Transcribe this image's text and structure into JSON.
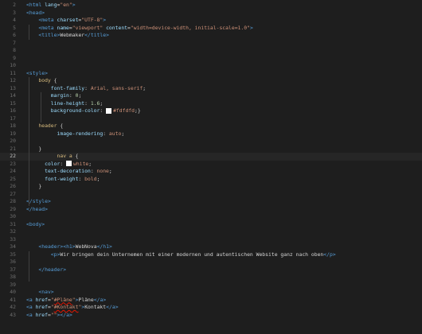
{
  "colors": {
    "background": "#1e1e1e",
    "tag": "#569cd6",
    "attr": "#9cdcfe",
    "string": "#ce9178",
    "selector": "#d7ba7d",
    "number": "#b5cea8",
    "text": "#d4d4d4",
    "brace": "#ffd700"
  },
  "editor": {
    "current_line": 22,
    "lines": [
      {
        "n": "2",
        "indent": 0,
        "t": [
          [
            "<",
            "tag"
          ],
          [
            "html",
            "tag"
          ],
          [
            " lang",
            "attr"
          ],
          [
            "=",
            "punc"
          ],
          [
            "\"en\"",
            "str"
          ],
          [
            ">",
            "tag"
          ]
        ]
      },
      {
        "n": "3",
        "indent": 0,
        "t": [
          [
            "<",
            "tag"
          ],
          [
            "head",
            "tag"
          ],
          [
            ">",
            "tag"
          ]
        ]
      },
      {
        "n": "4",
        "indent": 4,
        "t": [
          [
            "<",
            "tag"
          ],
          [
            "meta",
            "tag"
          ],
          [
            " charset",
            "attr"
          ],
          [
            "=",
            "punc"
          ],
          [
            "\"UTF-8\"",
            "str"
          ],
          [
            ">",
            "tag"
          ]
        ]
      },
      {
        "n": "5",
        "indent": 4,
        "t": [
          [
            "<",
            "tag"
          ],
          [
            "meta",
            "tag"
          ],
          [
            " name",
            "attr"
          ],
          [
            "=",
            "punc"
          ],
          [
            "\"viewport\"",
            "str"
          ],
          [
            " content",
            "attr"
          ],
          [
            "=",
            "punc"
          ],
          [
            "\"width=device-width, initial-scale=1.0\"",
            "str"
          ],
          [
            ">",
            "tag"
          ]
        ]
      },
      {
        "n": "6",
        "indent": 4,
        "t": [
          [
            "<",
            "tag"
          ],
          [
            "title",
            "tag"
          ],
          [
            ">",
            "tag"
          ],
          [
            "Webmaker",
            "text"
          ],
          [
            "</",
            "tag"
          ],
          [
            "title",
            "tag"
          ],
          [
            ">",
            "tag"
          ]
        ]
      },
      {
        "n": "7",
        "indent": 0,
        "t": []
      },
      {
        "n": "8",
        "indent": 0,
        "t": []
      },
      {
        "n": "9",
        "indent": 0,
        "t": []
      },
      {
        "n": "10",
        "indent": 0,
        "t": []
      },
      {
        "n": "11",
        "indent": 0,
        "t": [
          [
            "<",
            "tag"
          ],
          [
            "style",
            "tag"
          ],
          [
            ">",
            "tag"
          ]
        ]
      },
      {
        "n": "12",
        "indent": 4,
        "t": [
          [
            "body",
            "sel"
          ],
          [
            " {",
            "punc"
          ]
        ]
      },
      {
        "n": "13",
        "indent": 8,
        "t": [
          [
            "font-family",
            "prop"
          ],
          [
            ": ",
            "punc"
          ],
          [
            "Arial, sans-serif",
            "val"
          ],
          [
            ";",
            "punc"
          ]
        ]
      },
      {
        "n": "14",
        "indent": 8,
        "t": [
          [
            "margin",
            "prop"
          ],
          [
            ": ",
            "punc"
          ],
          [
            "0",
            "num"
          ],
          [
            ";",
            "punc"
          ]
        ]
      },
      {
        "n": "15",
        "indent": 8,
        "t": [
          [
            "line-height",
            "prop"
          ],
          [
            ": ",
            "punc"
          ],
          [
            "1.6",
            "num"
          ],
          [
            ";",
            "punc"
          ]
        ]
      },
      {
        "n": "16",
        "indent": 8,
        "t": [
          [
            "background-color",
            "prop"
          ],
          [
            ": ",
            "punc"
          ],
          [
            "swatch:#fdfdfd",
            "swatch"
          ],
          [
            "#fdfdfd",
            "val"
          ],
          [
            ";}",
            "punc"
          ]
        ]
      },
      {
        "n": "17",
        "indent": 0,
        "t": []
      },
      {
        "n": "18",
        "indent": 4,
        "t": [
          [
            "header",
            "sel"
          ],
          [
            " {",
            "punc"
          ]
        ]
      },
      {
        "n": "19",
        "indent": 10,
        "t": [
          [
            "image-rendering",
            "prop"
          ],
          [
            ": ",
            "punc"
          ],
          [
            "auto",
            "val"
          ],
          [
            ";",
            "punc"
          ]
        ]
      },
      {
        "n": "20",
        "indent": 0,
        "t": []
      },
      {
        "n": "21",
        "indent": 4,
        "t": [
          [
            "}",
            "punc"
          ]
        ]
      },
      {
        "n": "22",
        "indent": 10,
        "t": [
          [
            "nav a",
            "sel"
          ],
          [
            " {",
            "punc"
          ]
        ]
      },
      {
        "n": "23",
        "indent": 6,
        "t": [
          [
            "color",
            "prop"
          ],
          [
            ": ",
            "punc"
          ],
          [
            "swatch:#ffffff",
            "swatch"
          ],
          [
            "white",
            "val"
          ],
          [
            ";",
            "punc"
          ]
        ]
      },
      {
        "n": "24",
        "indent": 6,
        "t": [
          [
            "text-decoration",
            "prop"
          ],
          [
            ": ",
            "punc"
          ],
          [
            "none",
            "val"
          ],
          [
            ";",
            "punc"
          ]
        ]
      },
      {
        "n": "25",
        "indent": 6,
        "t": [
          [
            "font-weight",
            "prop"
          ],
          [
            ": ",
            "punc"
          ],
          [
            "bold",
            "val"
          ],
          [
            ";",
            "punc"
          ]
        ]
      },
      {
        "n": "26",
        "indent": 4,
        "t": [
          [
            "}",
            "punc"
          ]
        ]
      },
      {
        "n": "27",
        "indent": 0,
        "t": []
      },
      {
        "n": "28",
        "indent": 0,
        "t": [
          [
            "</",
            "tag"
          ],
          [
            "style",
            "tag"
          ],
          [
            ">",
            "tag"
          ]
        ]
      },
      {
        "n": "29",
        "indent": 0,
        "t": [
          [
            "</",
            "tag"
          ],
          [
            "head",
            "tag"
          ],
          [
            ">",
            "tag"
          ]
        ]
      },
      {
        "n": "30",
        "indent": 0,
        "t": []
      },
      {
        "n": "31",
        "indent": 0,
        "t": [
          [
            "<",
            "tag"
          ],
          [
            "body",
            "tag"
          ],
          [
            ">",
            "tag"
          ]
        ]
      },
      {
        "n": "32",
        "indent": 0,
        "t": []
      },
      {
        "n": "33",
        "indent": 0,
        "t": []
      },
      {
        "n": "34",
        "indent": 4,
        "t": [
          [
            "<",
            "tag"
          ],
          [
            "header",
            "tag"
          ],
          [
            ">",
            "tag"
          ],
          [
            "<",
            "tag"
          ],
          [
            "h1",
            "tag"
          ],
          [
            ">",
            "tag"
          ],
          [
            "WebNova",
            "text"
          ],
          [
            "</",
            "tag"
          ],
          [
            "h1",
            "tag"
          ],
          [
            ">",
            "tag"
          ]
        ]
      },
      {
        "n": "35",
        "indent": 8,
        "t": [
          [
            "<",
            "tag"
          ],
          [
            "p",
            "tag"
          ],
          [
            ">",
            "tag"
          ],
          [
            "Wir bringen dein Unternemen mit einer modernen und autentischen Website ganz nach oben",
            "text"
          ],
          [
            "</",
            "tag"
          ],
          [
            "p",
            "tag"
          ],
          [
            ">",
            "tag"
          ]
        ]
      },
      {
        "n": "36",
        "indent": 0,
        "t": []
      },
      {
        "n": "37",
        "indent": 4,
        "t": [
          [
            "</",
            "tag"
          ],
          [
            "header",
            "tag"
          ],
          [
            ">",
            "tag"
          ]
        ]
      },
      {
        "n": "38",
        "indent": 0,
        "t": []
      },
      {
        "n": "39",
        "indent": 0,
        "t": []
      },
      {
        "n": "40",
        "indent": 4,
        "t": [
          [
            "<",
            "tag"
          ],
          [
            "nav",
            "tag"
          ],
          [
            ">",
            "tag"
          ]
        ]
      },
      {
        "n": "41",
        "indent": 0,
        "t": [
          [
            "<",
            "tag"
          ],
          [
            "a",
            "tag"
          ],
          [
            " href",
            "attr"
          ],
          [
            "=",
            "punc"
          ],
          [
            "\"",
            "str"
          ],
          [
            "#Pläne",
            "strsq"
          ],
          [
            "\"",
            "str"
          ],
          [
            ">",
            "tag"
          ],
          [
            "Pläne",
            "text"
          ],
          [
            "</",
            "tag"
          ],
          [
            "a",
            "tag"
          ],
          [
            ">",
            "tag"
          ]
        ]
      },
      {
        "n": "42",
        "indent": 0,
        "t": [
          [
            "<",
            "tag"
          ],
          [
            "a",
            "tag"
          ],
          [
            " href",
            "attr"
          ],
          [
            "=",
            "punc"
          ],
          [
            "\"",
            "str"
          ],
          [
            "#Kontakt",
            "strsq"
          ],
          [
            "\"",
            "str"
          ],
          [
            ">",
            "tag"
          ],
          [
            "Kontakt",
            "text"
          ],
          [
            "</",
            "tag"
          ],
          [
            "a",
            "tag"
          ],
          [
            ">",
            "tag"
          ]
        ]
      },
      {
        "n": "43",
        "indent": 0,
        "t": [
          [
            "<",
            "tag"
          ],
          [
            "a",
            "tag"
          ],
          [
            " href",
            "attr"
          ],
          [
            "=",
            "punc"
          ],
          [
            "\"\"",
            "str"
          ],
          [
            ">",
            "tag"
          ],
          [
            "</",
            "tag"
          ],
          [
            "a",
            "tag"
          ],
          [
            ">",
            "tag"
          ]
        ]
      }
    ]
  }
}
